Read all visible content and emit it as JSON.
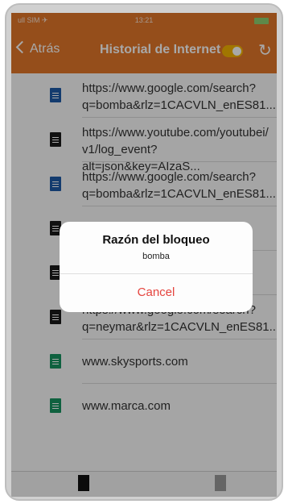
{
  "status_bar": {
    "carrier": "ull SIM ✈",
    "time": "13:21"
  },
  "navbar": {
    "back_label": "Atrás",
    "title": "Historial de Internet",
    "toggle_on": true,
    "refresh_icon": "refresh-icon"
  },
  "history": [
    {
      "icon": "document-icon",
      "color": "blue",
      "line1": "https://www.google.com/search?",
      "line2": "q=bomba&rlz=1CACVLN_enES81..."
    },
    {
      "icon": "document-icon",
      "color": "dark",
      "line1": "https://www.youtube.com/youtubei/",
      "line2": "v1/log_event?alt=json&key=AIzaS..."
    },
    {
      "icon": "document-icon",
      "color": "blue",
      "line1": "https://www.google.com/search?",
      "line2": "q=bomba&rlz=1CACVLN_enES81..."
    },
    {
      "icon": "document-icon",
      "color": "dark",
      "line1": "",
      "line2": ""
    },
    {
      "icon": "document-icon",
      "color": "dark",
      "line1": "",
      "line2": ""
    },
    {
      "icon": "document-icon",
      "color": "dark",
      "line1": "https://www.google.com/search?",
      "line2": "q=neymar&rlz=1CACVLN_enES81..."
    },
    {
      "icon": "document-icon",
      "color": "green",
      "line1": "www.skysports.com",
      "line2": ""
    },
    {
      "icon": "document-icon",
      "color": "green",
      "line1": "www.marca.com",
      "line2": ""
    }
  ],
  "dialog": {
    "title": "Razón del bloqueo",
    "message": "bomba",
    "cancel_label": "Cancel"
  },
  "colors": {
    "accent": "#e2772a",
    "cancel": "#e5443e",
    "toggle": "#f4b400"
  }
}
